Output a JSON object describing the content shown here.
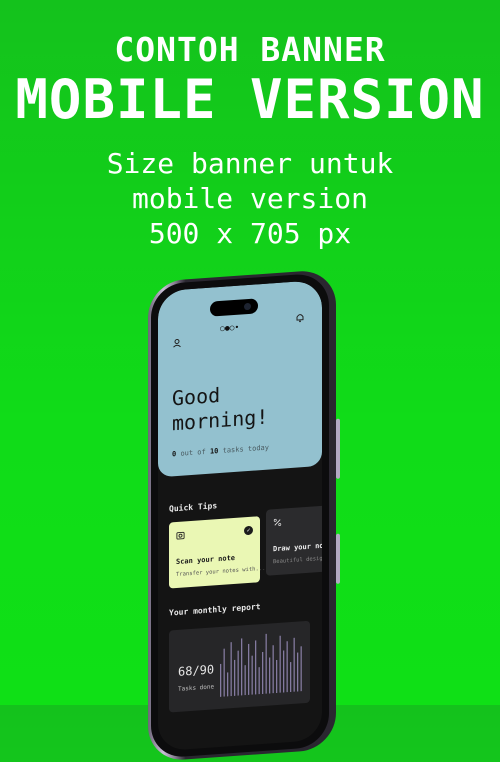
{
  "banner": {
    "title_line1": "CONTOH BANNER",
    "title_line2": "MOBILE VERSION",
    "subtitle_line1": "Size banner untuk",
    "subtitle_line2": "mobile version",
    "subtitle_line3": "500 x 705 px",
    "background_color": "#10d418"
  },
  "app": {
    "greeting_line1": "Good",
    "greeting_line2": "morning!",
    "tasks_done": "0",
    "tasks_mid": "out of",
    "tasks_total": "10",
    "tasks_suffix": "tasks today",
    "quick_tips_title": "Quick Tips",
    "tips": [
      {
        "title": "Scan your note",
        "text": "Transfer your notes with...",
        "icon": "scan-icon"
      },
      {
        "title": "Draw your note",
        "text": "Beautiful design",
        "icon": "pen-icon"
      }
    ],
    "report_title": "Your monthly report",
    "report_score": "68/90",
    "report_caption": "Tasks done",
    "report_bars": [
      0.55,
      0.8,
      0.4,
      0.9,
      0.6,
      0.75,
      0.95,
      0.5,
      0.85,
      0.65,
      0.9,
      0.45,
      0.7,
      1.0,
      0.6,
      0.8,
      0.55,
      0.95,
      0.7,
      0.85,
      0.5,
      0.9,
      0.65,
      0.75
    ],
    "hero_color": "#93c1cf",
    "tip_card_color": "#eaf7b4"
  }
}
